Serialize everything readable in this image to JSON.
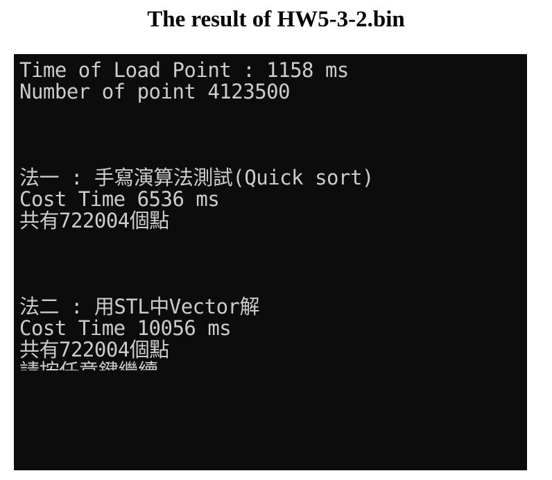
{
  "page": {
    "title": "The result of HW5-3-2.bin"
  },
  "console": {
    "lines": [
      "Time of Load Point : 1158 ms",
      "Number of point 4123500",
      "",
      "",
      "",
      "法一 : 手寫演算法測試(Quick sort)",
      "Cost Time 6536 ms",
      "共有722004個點",
      "",
      "",
      "",
      "法二 : 用STL中Vector解",
      "Cost Time 10056 ms",
      "共有722004個點",
      "請按任意鍵繼續"
    ],
    "background_color": "#0c0c0c",
    "text_color": "#cccccc"
  }
}
